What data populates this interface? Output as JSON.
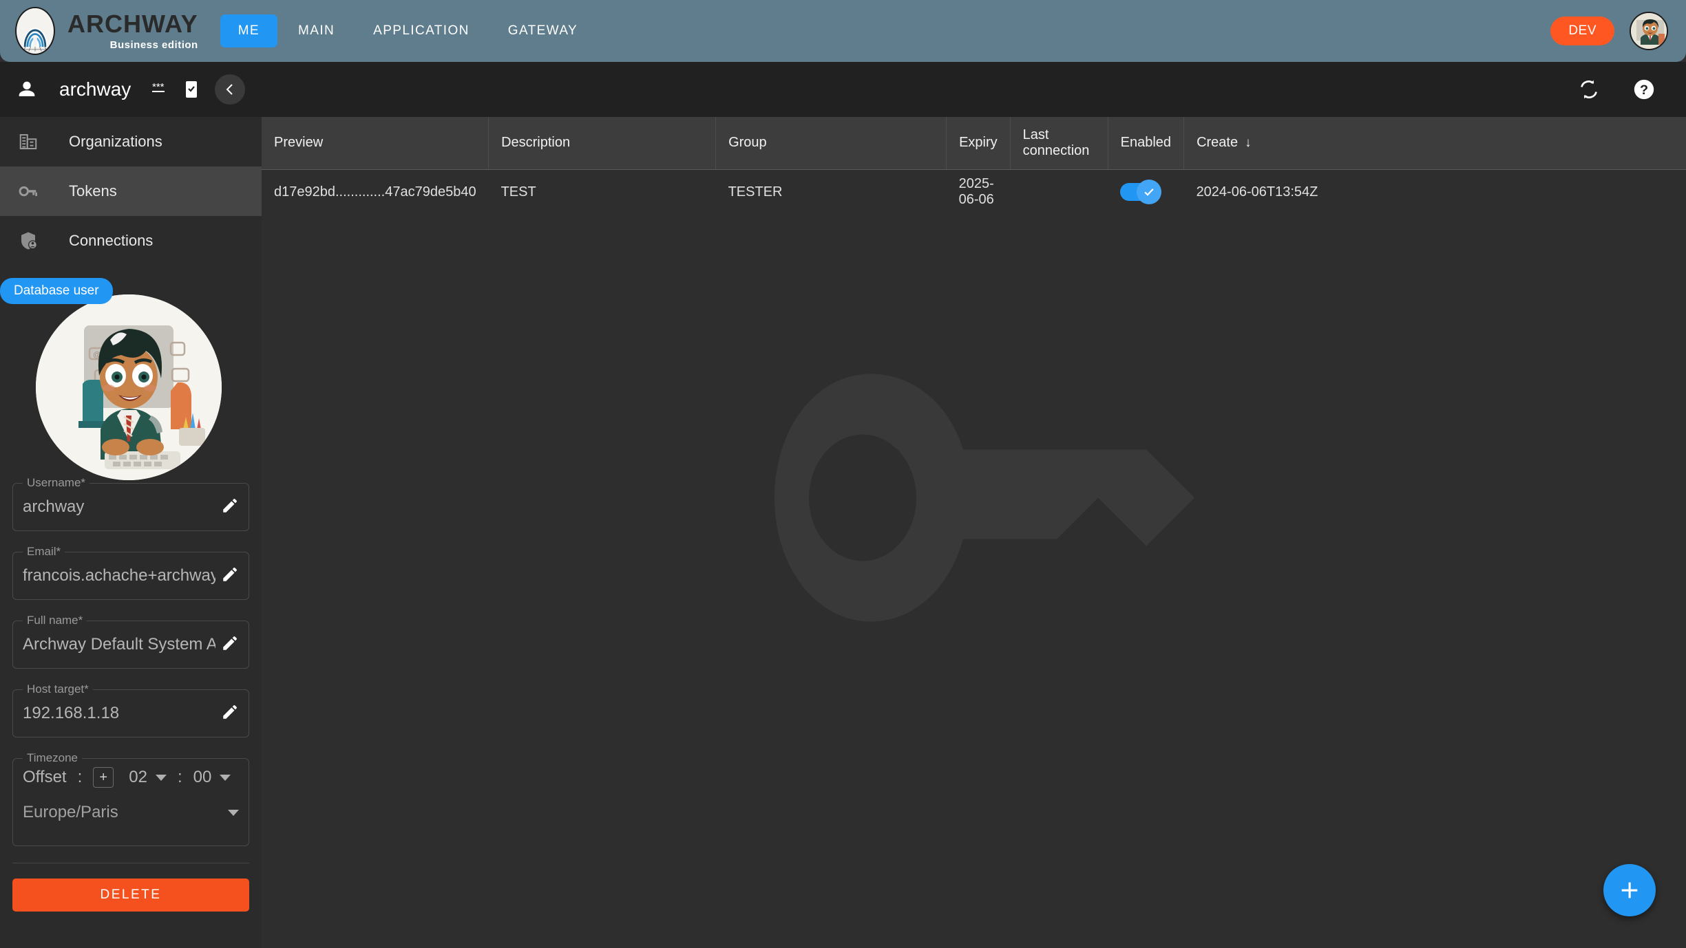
{
  "header": {
    "logo_title": "ARCHWAY",
    "logo_subtitle": "Business edition",
    "nav": [
      {
        "label": "ME",
        "active": true
      },
      {
        "label": "MAIN",
        "active": false
      },
      {
        "label": "APPLICATION",
        "active": false
      },
      {
        "label": "GATEWAY",
        "active": false
      }
    ],
    "env_badge": "DEV",
    "accent_blue": "#2196f3",
    "badge_orange": "#ff5722",
    "bar_color": "#5f7d8c"
  },
  "subbar": {
    "title": "archway",
    "icons": {
      "person": "person-icon",
      "password": "password-dots-icon",
      "mobile": "mobile-check-icon",
      "collapse": "chevron-left-icon",
      "refresh": "sync-refresh-icon",
      "help": "help-circle-icon"
    }
  },
  "sidebar": {
    "items": [
      {
        "label": "Organizations",
        "icon": "building-icon",
        "selected": false
      },
      {
        "label": "Tokens",
        "icon": "key-icon",
        "selected": true
      },
      {
        "label": "Connections",
        "icon": "shield-person-icon",
        "selected": false
      }
    ],
    "badge": "Database user",
    "fields": [
      {
        "label": "Username*",
        "value": "archway"
      },
      {
        "label": "Email*",
        "value": "francois.achache+archway@"
      },
      {
        "label": "Full name*",
        "value": "Archway Default System Adm"
      },
      {
        "label": "Host target*",
        "value": "192.168.1.18"
      }
    ],
    "timezone": {
      "label": "Timezone",
      "offset_label": "Offset",
      "separator": ":",
      "sign": "+",
      "hours": "02",
      "minutes": "00",
      "zone": "Europe/Paris"
    },
    "delete_label": "DELETE"
  },
  "table": {
    "columns": [
      "Preview",
      "Description",
      "Group",
      "Expiry",
      "Last connection",
      "Enabled",
      "Create"
    ],
    "sort_column": "Create",
    "sort_arrow": "↓",
    "rows": [
      {
        "preview": "d17e92bd.............47ac79de5b40",
        "description": "TEST",
        "group": "TESTER",
        "expiry": "2025-06-06",
        "last_connection": "",
        "enabled": true,
        "create": "2024-06-06T13:54Z"
      }
    ]
  },
  "fab": {
    "icon": "plus-icon"
  }
}
